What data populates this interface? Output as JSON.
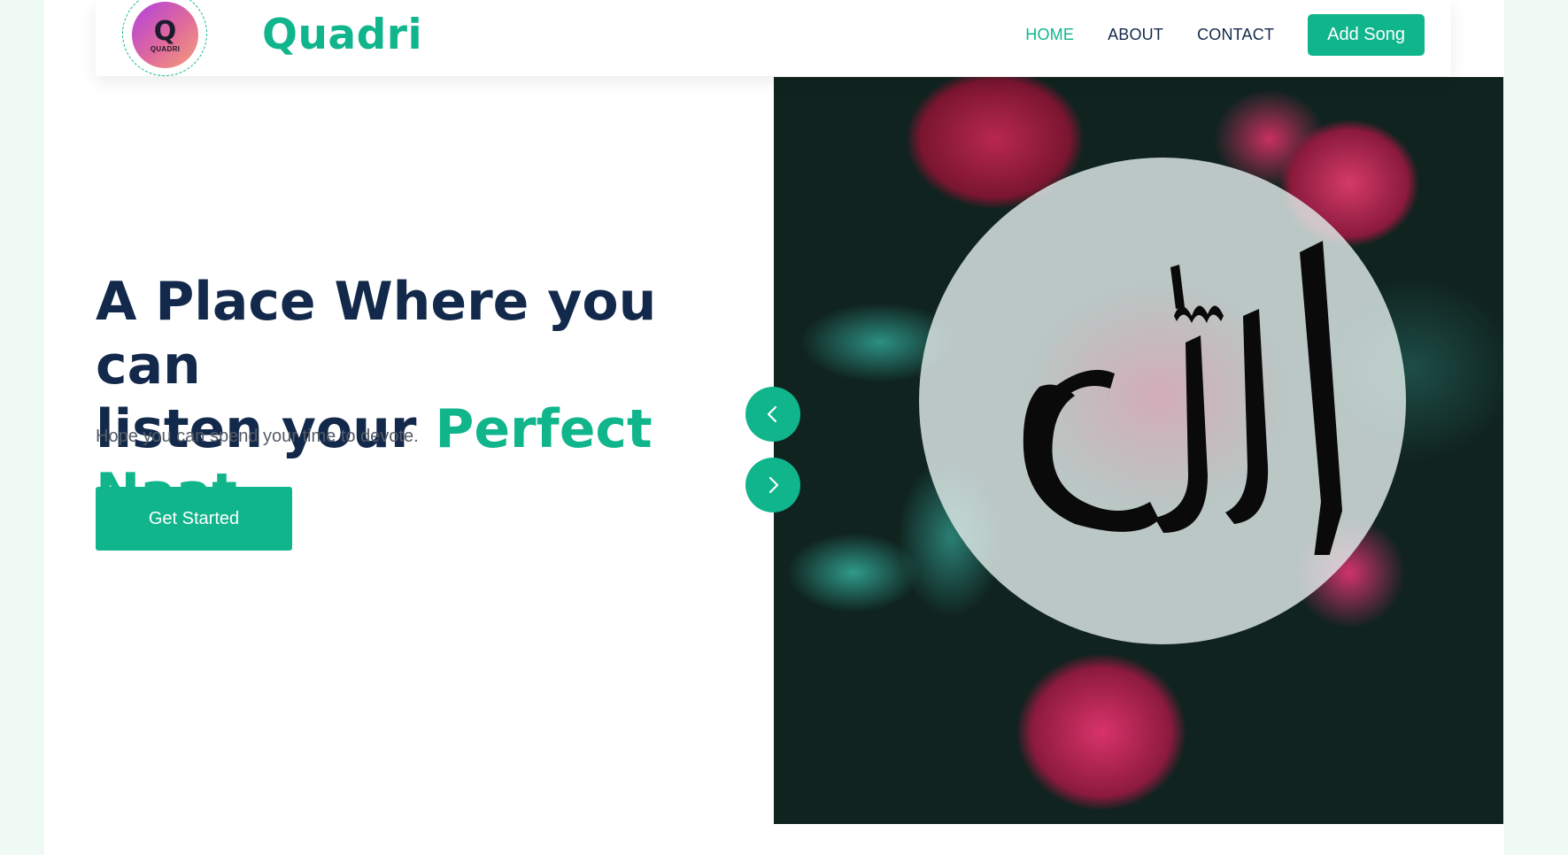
{
  "header": {
    "logo_text": "QUADRI",
    "brand": "Quadri",
    "nav": [
      {
        "label": "HOME",
        "active": true
      },
      {
        "label": "ABOUT",
        "active": false
      },
      {
        "label": "CONTACT",
        "active": false
      }
    ],
    "add_button": "Add Song"
  },
  "hero": {
    "title_line1": "A Place Where you can",
    "title_line2": "listen your ",
    "title_accent": "Perfect Naat",
    "subtitle": "Hope you can spend your time to devote.",
    "cta_label": "Get Started"
  },
  "slider": {
    "prev_icon": "chevron-left-icon",
    "next_icon": "chevron-right-icon"
  },
  "colors": {
    "accent": "#10b58c",
    "heading": "#13294b",
    "page_background": "#f0faf4"
  }
}
